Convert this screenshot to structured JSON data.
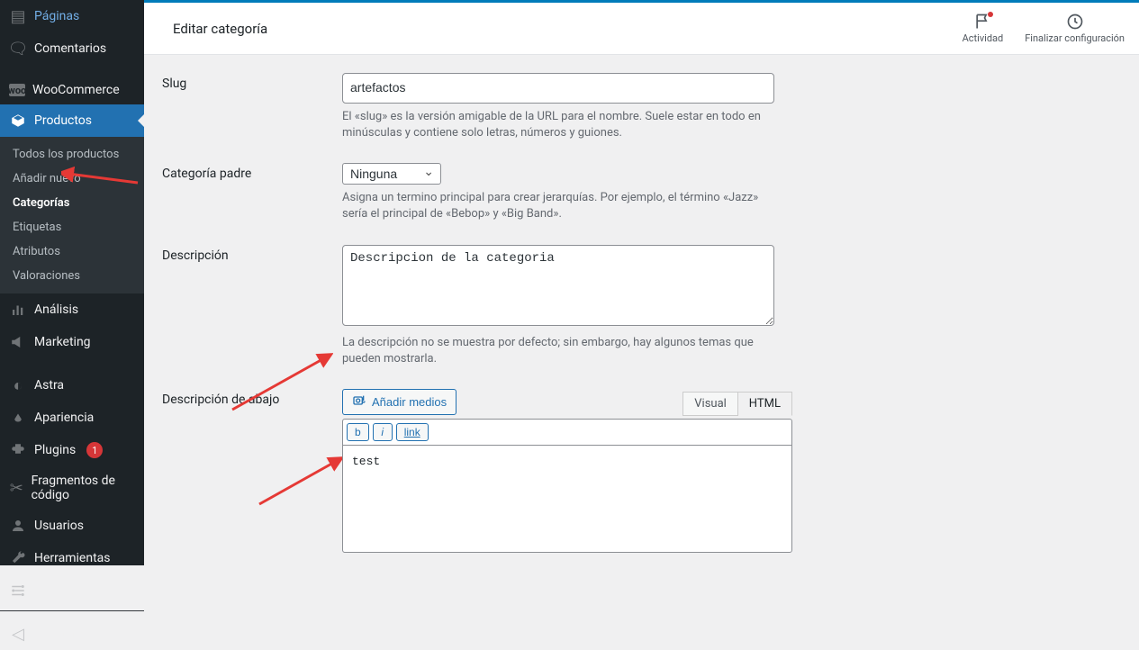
{
  "header": {
    "title": "Editar categoría",
    "actions": {
      "activity": "Actividad",
      "finish": "Finalizar configuración"
    }
  },
  "sidebar": {
    "items": {
      "paginas": "Páginas",
      "comentarios": "Comentarios",
      "woocommerce": "WooCommerce",
      "productos": "Productos",
      "analisis": "Análisis",
      "marketing": "Marketing",
      "astra": "Astra",
      "apariencia": "Apariencia",
      "plugins": "Plugins",
      "plugins_count": "1",
      "fragmentos": "Fragmentos de código",
      "usuarios": "Usuarios",
      "herramientas": "Herramientas",
      "ajustes": "Ajustes",
      "cerrar": "Cerrar menú"
    },
    "submenu": {
      "todos": "Todos los productos",
      "anadir": "Añadir nuevo",
      "categorias": "Categorías",
      "etiquetas": "Etiquetas",
      "atributos": "Atributos",
      "valoraciones": "Valoraciones"
    }
  },
  "form": {
    "slug": {
      "label": "Slug",
      "value": "artefactos",
      "help": "El «slug» es la versión amigable de la URL para el nombre. Suele estar en todo en minúsculas y contiene solo letras, números y guiones."
    },
    "parent": {
      "label": "Categoría padre",
      "selected": "Ninguna",
      "help": "Asigna un termino principal para crear jerarquías. Por ejemplo, el término «Jazz» sería el principal de «Bebop» y «Big Band»."
    },
    "description": {
      "label": "Descripción",
      "value": "Descripcion de la categoria",
      "help": "La descripción no se muestra por defecto; sin embargo, hay algunos temas que pueden mostrarla."
    },
    "bottom_description": {
      "label": "Descripción de abajo",
      "add_media": "Añadir medios",
      "tab_visual": "Visual",
      "tab_html": "HTML",
      "btn_b": "b",
      "btn_i": "i",
      "btn_link": "link",
      "content": "test"
    }
  }
}
